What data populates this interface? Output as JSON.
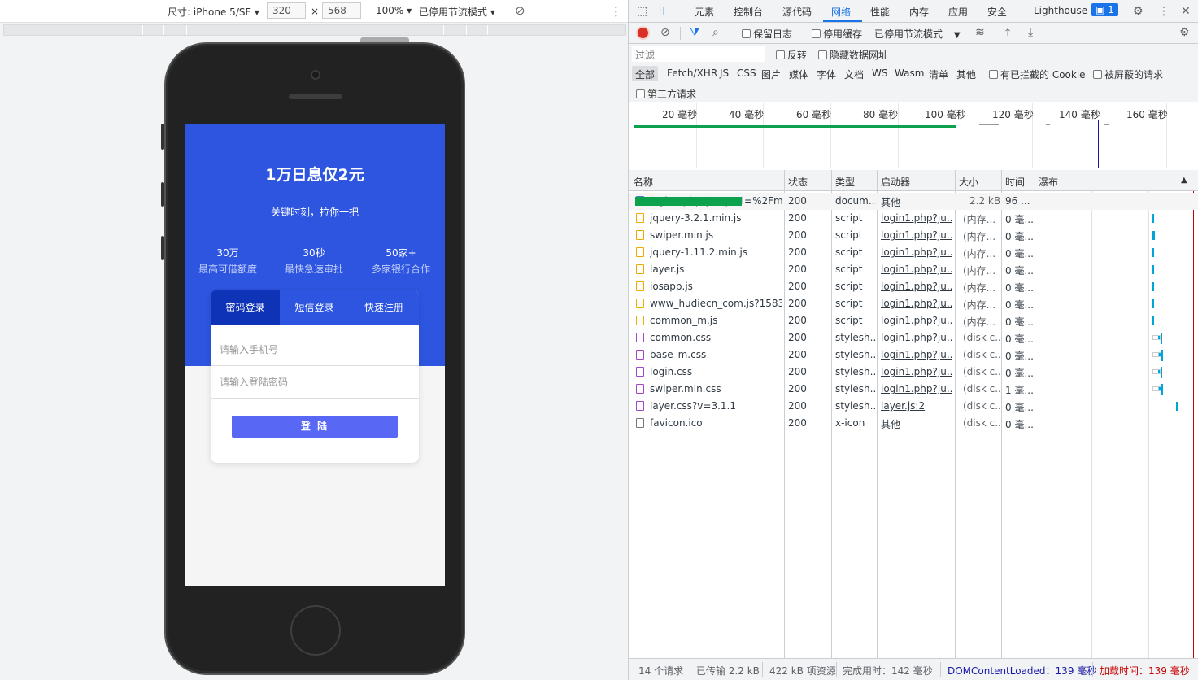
{
  "device_toolbar": {
    "device_label": "尺寸: iPhone 5/SE",
    "width": "320",
    "times": "×",
    "height": "568",
    "zoom": "100%",
    "throttle": "已停用节流模式",
    "more": "⋮"
  },
  "page": {
    "title": "1万日息仅2元",
    "subtitle": "关键时刻，拉你一把",
    "stats": [
      {
        "value": "30万",
        "label": "最高可借额度"
      },
      {
        "value": "30秒",
        "label": "最快急速审批"
      },
      {
        "value": "50家+",
        "label": "多家银行合作"
      }
    ],
    "tabs": [
      "密码登录",
      "短信登录",
      "快速注册"
    ],
    "phone_placeholder": "请输入手机号",
    "password_placeholder": "请输入登陆密码",
    "login_button": "登 陆"
  },
  "devtools": {
    "tabs": [
      "元素",
      "控制台",
      "源代码",
      "网络",
      "性能",
      "内存",
      "应用",
      "安全",
      "Lighthouse"
    ],
    "active_tab": "网络",
    "issues_badge": "1",
    "toolbar": {
      "preserve_log": "保留日志",
      "disable_cache": "停用缓存",
      "throttle": "已停用节流模式"
    },
    "filter_placeholder": "过滤",
    "invert": "反转",
    "hide_data_urls": "隐藏数据网址",
    "types": [
      "全部",
      "Fetch/XHR",
      "JS",
      "CSS",
      "图片",
      "媒体",
      "字体",
      "文档",
      "WS",
      "Wasm",
      "清单",
      "其他"
    ],
    "blocked_cookies": "有已拦截的 Cookie",
    "blocked_requests": "被屏蔽的请求",
    "third_party": "第三方请求",
    "timeline_labels": [
      "20 毫秒",
      "40 毫秒",
      "60 毫秒",
      "80 毫秒",
      "100 毫秒",
      "120 毫秒",
      "140 毫秒",
      "160 毫秒"
    ],
    "columns": [
      "名称",
      "状态",
      "类型",
      "启动器",
      "大小",
      "时间",
      "瀑布"
    ],
    "rows": [
      {
        "name": "login1.php?jumpurl=%2Fm1...",
        "status": "200",
        "type": "docum...",
        "initiator": "其他",
        "size": "2.2 kB",
        "time": "96 ...",
        "kind": "doc"
      },
      {
        "name": "jquery-3.2.1.min.js",
        "status": "200",
        "type": "script",
        "initiator": "login1.php?ju...",
        "size": "(内存...",
        "time": "0 毫...",
        "kind": "js"
      },
      {
        "name": "swiper.min.js",
        "status": "200",
        "type": "script",
        "initiator": "login1.php?ju...",
        "size": "(内存...",
        "time": "0 毫...",
        "kind": "js"
      },
      {
        "name": "jquery-1.11.2.min.js",
        "status": "200",
        "type": "script",
        "initiator": "login1.php?ju...",
        "size": "(内存...",
        "time": "0 毫...",
        "kind": "js"
      },
      {
        "name": "layer.js",
        "status": "200",
        "type": "script",
        "initiator": "login1.php?ju...",
        "size": "(内存...",
        "time": "0 毫...",
        "kind": "js"
      },
      {
        "name": "iosapp.js",
        "status": "200",
        "type": "script",
        "initiator": "login1.php?ju...",
        "size": "(内存...",
        "time": "0 毫...",
        "kind": "js"
      },
      {
        "name": "www_hudiecn_com.js?15835...",
        "status": "200",
        "type": "script",
        "initiator": "login1.php?ju...",
        "size": "(内存...",
        "time": "0 毫...",
        "kind": "js"
      },
      {
        "name": "common_m.js",
        "status": "200",
        "type": "script",
        "initiator": "login1.php?ju...",
        "size": "(内存...",
        "time": "0 毫...",
        "kind": "js"
      },
      {
        "name": "common.css",
        "status": "200",
        "type": "stylesh...",
        "initiator": "login1.php?ju...",
        "size": "(disk c...",
        "time": "0 毫...",
        "kind": "css"
      },
      {
        "name": "base_m.css",
        "status": "200",
        "type": "stylesh...",
        "initiator": "login1.php?ju...",
        "size": "(disk c...",
        "time": "0 毫...",
        "kind": "css"
      },
      {
        "name": "login.css",
        "status": "200",
        "type": "stylesh...",
        "initiator": "login1.php?ju...",
        "size": "(disk c...",
        "time": "0 毫...",
        "kind": "css"
      },
      {
        "name": "swiper.min.css",
        "status": "200",
        "type": "stylesh...",
        "initiator": "login1.php?ju...",
        "size": "(disk c...",
        "time": "1 毫...",
        "kind": "css"
      },
      {
        "name": "layer.css?v=3.1.1",
        "status": "200",
        "type": "stylesh...",
        "initiator": "layer.js:2",
        "size": "(disk c...",
        "time": "0 毫...",
        "kind": "css"
      },
      {
        "name": "favicon.ico",
        "status": "200",
        "type": "x-icon",
        "initiator": "其他",
        "size": "(disk c...",
        "time": "0 毫...",
        "kind": "ico"
      }
    ],
    "status_bar": {
      "requests": "14 个请求",
      "transferred": "已传输 2.2 kB",
      "resources": "422 kB 项资源",
      "finish": "完成用时：142 毫秒",
      "dcl": "DOMContentLoaded：139 毫秒",
      "load": "加载时间：139 毫秒"
    },
    "colors": {
      "accent": "#1a73e8",
      "dcl": "#1a1aa6",
      "load": "#c80000",
      "doc_bar": "#0ca14d",
      "res_bar": "#00a4d6"
    }
  }
}
